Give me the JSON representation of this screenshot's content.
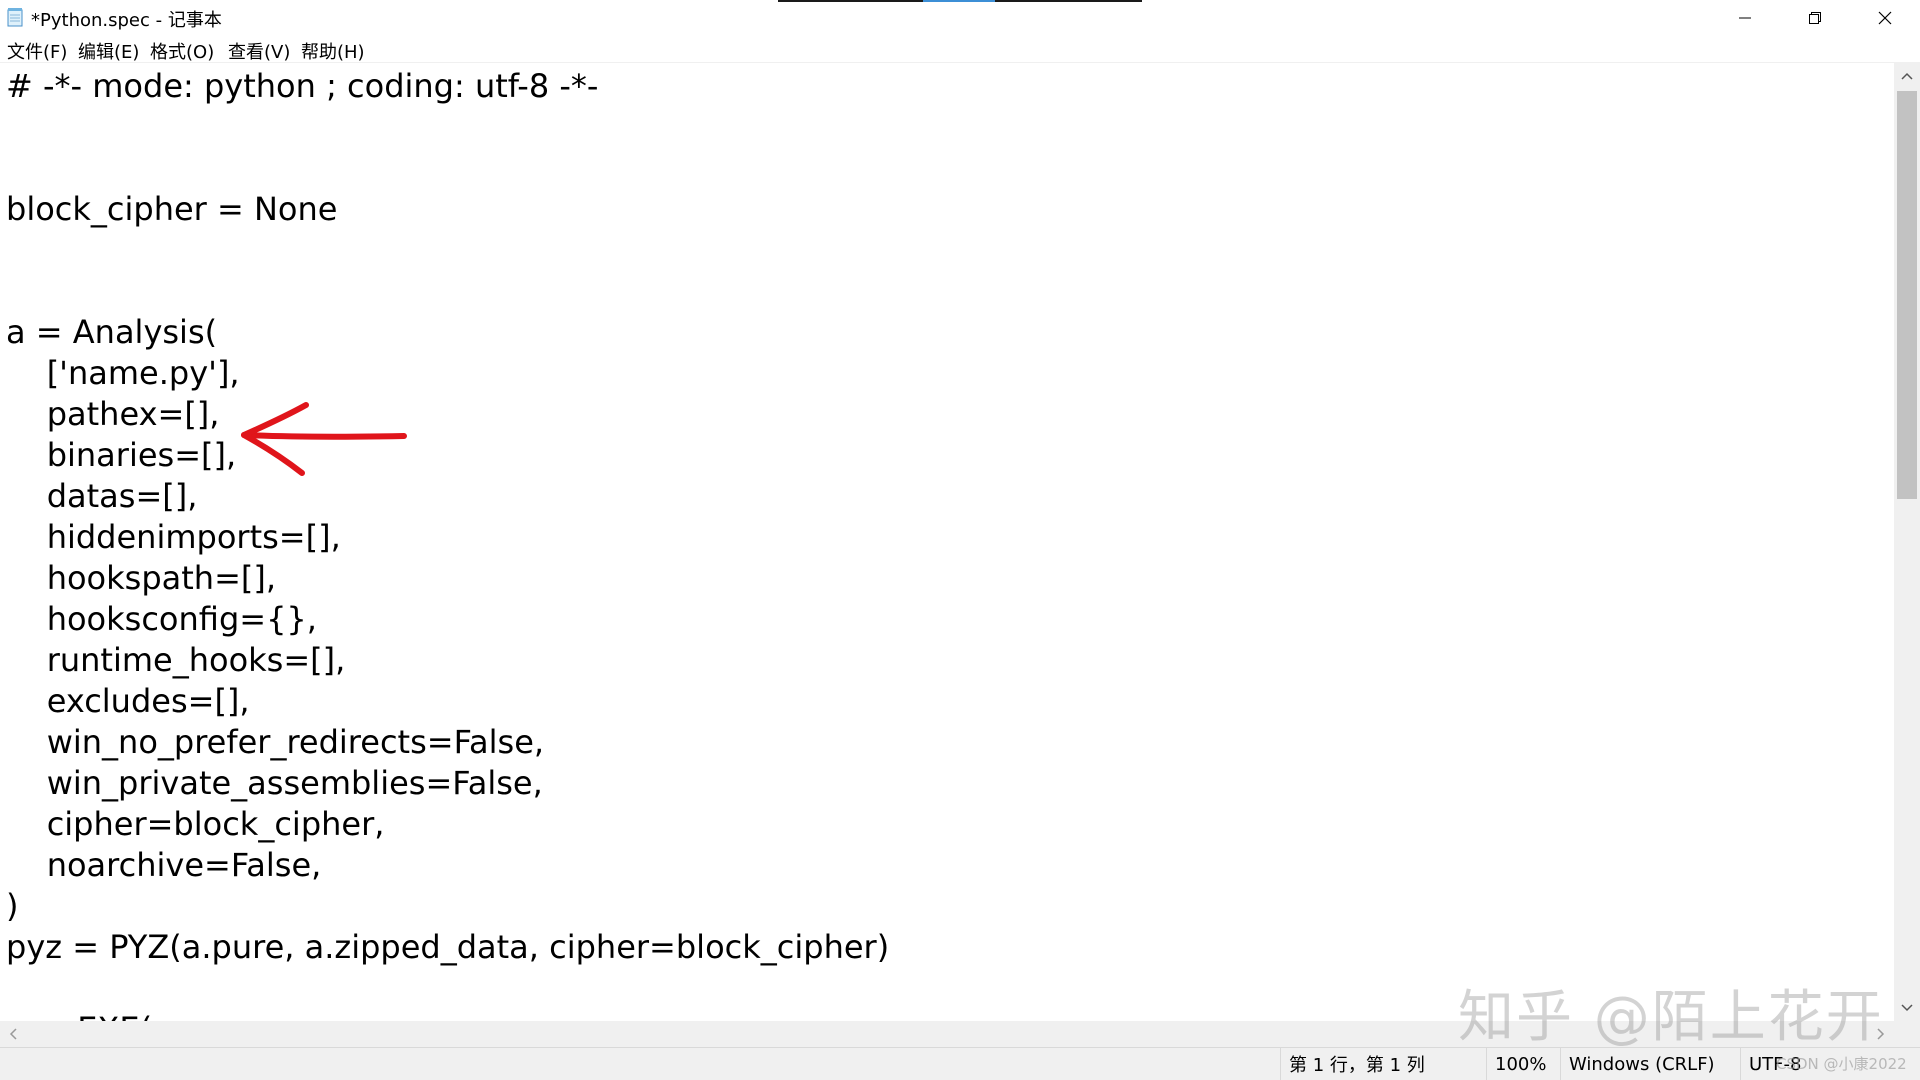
{
  "window": {
    "title": "*Python.spec - 记事本"
  },
  "menu": {
    "file": "文件(F)",
    "edit": "编辑(E)",
    "format": "格式(O)",
    "view": "查看(V)",
    "help": "帮助(H)"
  },
  "editor": {
    "lines": [
      "# -*- mode: python ; coding: utf-8 -*-",
      "",
      "",
      "block_cipher = None",
      "",
      "",
      "a = Analysis(",
      "    ['name.py'],",
      "    pathex=[],",
      "    binaries=[],",
      "    datas=[],",
      "    hiddenimports=[],",
      "    hookspath=[],",
      "    hooksconfig={},",
      "    runtime_hooks=[],",
      "    excludes=[],",
      "    win_no_prefer_redirects=False,",
      "    win_private_assemblies=False,",
      "    cipher=block_cipher,",
      "    noarchive=False,",
      ")",
      "pyz = PYZ(a.pure, a.zipped_data, cipher=block_cipher)",
      "",
      "       EXE("
    ],
    "annotation_color": "#e0151b"
  },
  "status": {
    "position": "第 1 行，第 1 列",
    "zoom": "100%",
    "line_ending": "Windows (CRLF)",
    "encoding": "UTF-8"
  },
  "watermarks": {
    "zhihu": "知乎 @陌上花开",
    "csdn": "CSDN @小康2022"
  }
}
